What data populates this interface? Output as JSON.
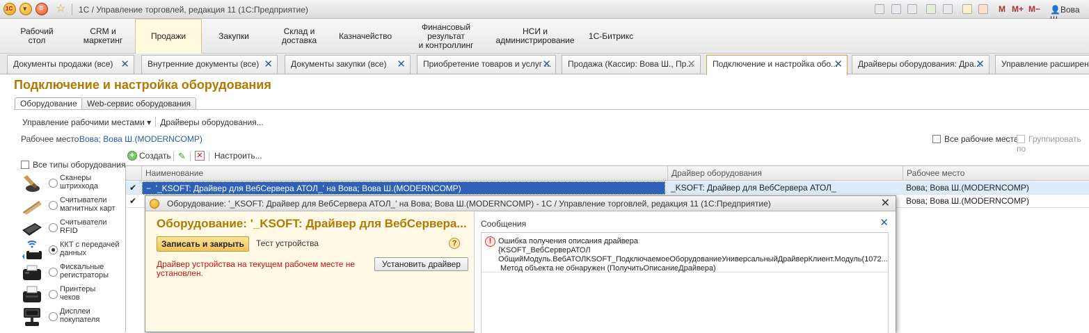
{
  "titlebar": {
    "title": "1С / Управление торговлей, редакция 11  (1С:Предприятие)",
    "logo_text": "1С",
    "toolbar_m": "M",
    "toolbar_mplus": "M+",
    "toolbar_mminus": "M−",
    "user": "Вова Ш."
  },
  "sections": [
    {
      "label": "Рабочий\nстол"
    },
    {
      "label": "CRM и\nмаркетинг"
    },
    {
      "label": "Продажи"
    },
    {
      "label": "Закупки"
    },
    {
      "label": "Склад и\nдоставка"
    },
    {
      "label": "Казначейство"
    },
    {
      "label": "Финансовый результат\nи контроллинг"
    },
    {
      "label": "НСИ и\nадминистрирование"
    },
    {
      "label": "1С-Битрикс"
    }
  ],
  "window_tabs": [
    {
      "label": "Документы продажи (все)"
    },
    {
      "label": "Внутренние документы (все)"
    },
    {
      "label": "Документы закупки (все)"
    },
    {
      "label": "Приобретение товаров и услуг ..."
    },
    {
      "label": "Продажа (Кассир: Вова Ш., Пр..."
    },
    {
      "label": "Подключение и настройка обо..."
    },
    {
      "label": "Драйверы оборудования: Дра..."
    },
    {
      "label": "Управление расширения"
    }
  ],
  "form": {
    "title": "Подключение и настройка оборудования",
    "tabs": [
      {
        "label": "Оборудование"
      },
      {
        "label": "Web-сервис оборудования"
      }
    ],
    "manage_workplaces": "Управление рабочими местами",
    "drivers": "Драйверы оборудования...",
    "workplace_label": "Рабочее место:",
    "workplace_value": "Вова; Вова Ш.(MODERNCOMP)",
    "all_workplaces": "Все рабочие места",
    "group_by": "Группировать по",
    "all_types": "Все типы оборудования",
    "types": [
      {
        "label": "Сканеры\nштрихкода",
        "icon": "barcode-scanner-icon"
      },
      {
        "label": "Считыватели\nмагнитных карт",
        "icon": "card-reader-icon"
      },
      {
        "label": "Считыватели\nRFID",
        "icon": "rfid-reader-icon"
      },
      {
        "label": "ККТ с передачей\nданных",
        "icon": "kkt-icon"
      },
      {
        "label": "Фискальные\nрегистраторы",
        "icon": "fiscal-register-icon"
      },
      {
        "label": "Принтеры\nчеков",
        "icon": "receipt-printer-icon"
      },
      {
        "label": "Дисплеи\nпокупателя",
        "icon": "customer-display-icon"
      }
    ],
    "selected_type": 3,
    "cmd_create": "Создать",
    "cmd_setup": "Настроить...",
    "columns": [
      "Наименование",
      "Драйвер оборудования",
      "Рабочее место"
    ],
    "rows": [
      {
        "checked": "✔",
        "name": "'_KSOFT: Драйвер для ВебСервера АТОЛ_' на Вова; Вова Ш.(MODERNCOMP)",
        "driver": "_KSOFT: Драйвер для ВебСервера АТОЛ_",
        "workplace": "Вова; Вова Ш.(MODERNCOMP)"
      },
      {
        "checked": "✔",
        "name": "",
        "driver": "",
        "workplace": "Вова; Вова Ш.(MODERNCOMP)"
      }
    ],
    "row_marker": "−"
  },
  "dialog": {
    "title": "Оборудование: '_KSOFT: Драйвер для ВебСервера АТОЛ_' на Вова; Вова Ш.(MODERNCOMP) - 1С / Управление торговлей, редакция 11  (1С:Предприятие)",
    "heading": "Оборудование: '_KSOFT: Драйвер для ВебСервера...",
    "save_close": "Записать и закрыть",
    "test_device": "Тест устройства",
    "help": "?",
    "warning": "Драйвер устройства на текущем рабочем месте не установлен.",
    "install_driver": "Установить драйвер",
    "messages_title": "Сообщения",
    "message_lines": [
      "Ошибка получения описания драйвера",
      "{KSOFT_ВебСерверАТОЛ",
      "ОбщийМодуль.ВебАТОЛKSOFT_ПодключаемоеОборудованиеУниверсальныйДрайверКлиент.Модуль(1072...",
      " Метод объекта не обнаружен (ПолучитьОписаниеДрайвера)"
    ]
  },
  "colors": {
    "accent": "#b07a00",
    "link": "#1f5fa5",
    "error": "#c6120f",
    "selection": "#2f62b7"
  }
}
